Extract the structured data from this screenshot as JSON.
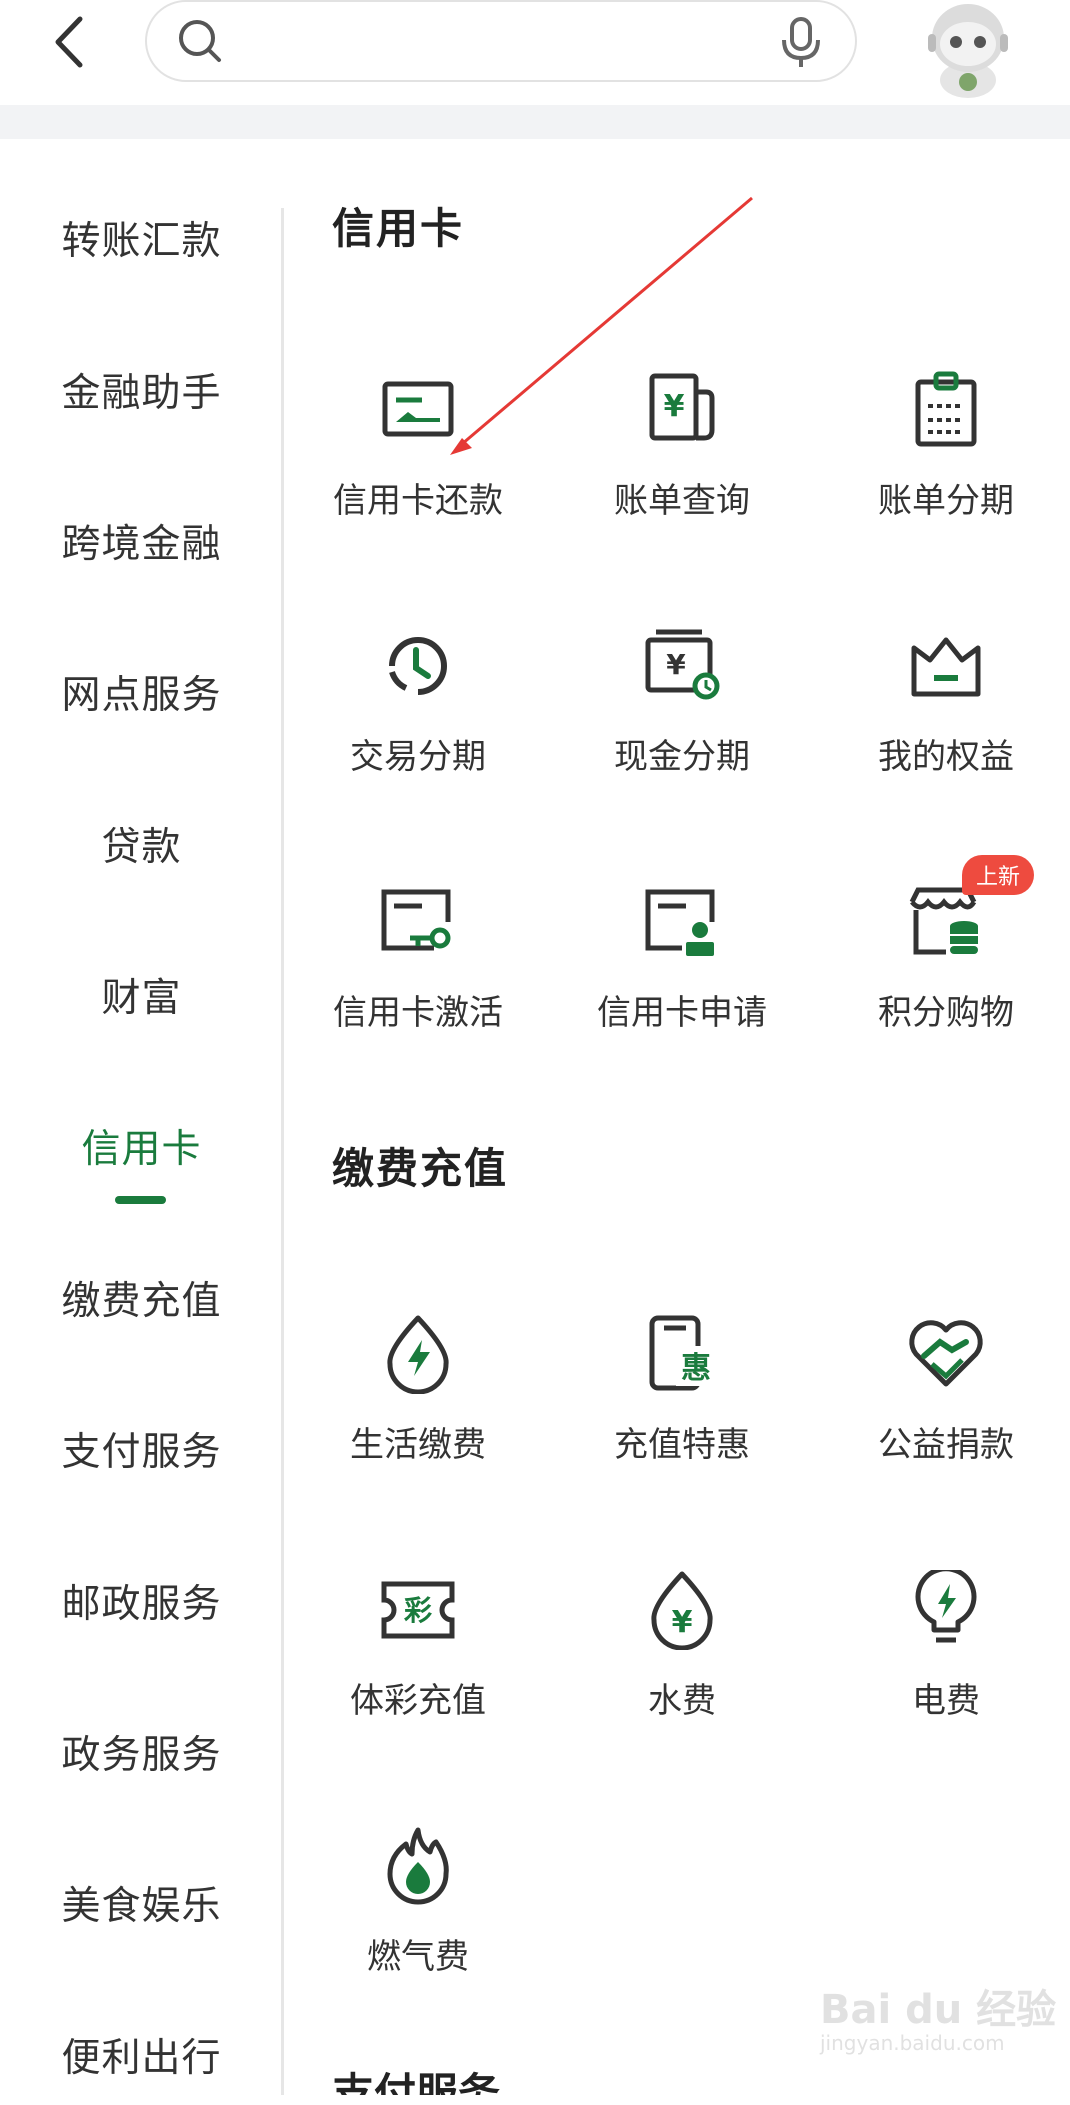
{
  "header": {
    "search_placeholder": "",
    "back_icon": "chevron-left-icon",
    "search_icon": "search-icon",
    "mic_icon": "microphone-icon",
    "avatar": "robot-assistant-avatar"
  },
  "sidebar": {
    "items": [
      {
        "label": "转账汇款"
      },
      {
        "label": "金融助手"
      },
      {
        "label": "跨境金融"
      },
      {
        "label": "网点服务"
      },
      {
        "label": "贷款"
      },
      {
        "label": "财富"
      },
      {
        "label": "信用卡"
      },
      {
        "label": "缴费充值"
      },
      {
        "label": "支付服务"
      },
      {
        "label": "邮政服务"
      },
      {
        "label": "政务服务"
      },
      {
        "label": "美食娱乐"
      },
      {
        "label": "便利出行"
      }
    ],
    "active_label": "信用卡"
  },
  "sections": {
    "credit_card": {
      "title": "信用卡",
      "tiles": [
        {
          "label": "信用卡还款",
          "icon": "card-repay-icon"
        },
        {
          "label": "账单查询",
          "icon": "bill-query-icon"
        },
        {
          "label": "账单分期",
          "icon": "bill-installment-icon"
        },
        {
          "label": "交易分期",
          "icon": "transaction-installment-icon"
        },
        {
          "label": "现金分期",
          "icon": "cash-installment-icon"
        },
        {
          "label": "我的权益",
          "icon": "crown-icon"
        },
        {
          "label": "信用卡激活",
          "icon": "card-activate-icon"
        },
        {
          "label": "信用卡申请",
          "icon": "card-apply-icon"
        },
        {
          "label": "积分购物",
          "icon": "points-shopping-icon",
          "badge": "上新"
        }
      ]
    },
    "payment": {
      "title": "缴费充值",
      "tiles": [
        {
          "label": "生活缴费",
          "icon": "life-payment-icon"
        },
        {
          "label": "充值特惠",
          "icon": "recharge-discount-icon"
        },
        {
          "label": "公益捐款",
          "icon": "charity-heart-icon"
        },
        {
          "label": "体彩充值",
          "icon": "lottery-ticket-icon"
        },
        {
          "label": "水费",
          "icon": "water-drop-icon"
        },
        {
          "label": "电费",
          "icon": "electricity-bulb-icon"
        },
        {
          "label": "燃气费",
          "icon": "gas-flame-icon"
        }
      ]
    },
    "next_title": "支付服务"
  },
  "watermark": {
    "main": "Bai du 经验",
    "sub": "jingyan.baidu.com"
  },
  "colors": {
    "accent": "#1a7b3d",
    "icon_dark": "#333333",
    "badge": "#ee4b3f",
    "annotation_arrow": "#e53935"
  }
}
